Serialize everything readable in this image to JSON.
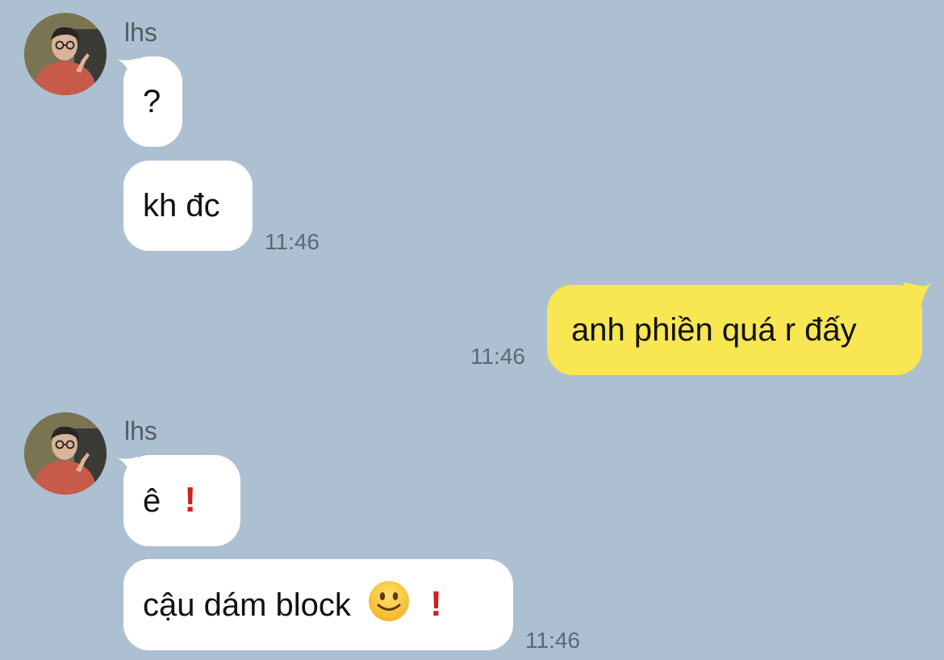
{
  "chat": {
    "groups": [
      {
        "sender": "lhs",
        "messages": [
          {
            "text": "?"
          },
          {
            "text": "kh đc",
            "time": "11:46"
          }
        ]
      },
      {
        "own": true,
        "messages": [
          {
            "text": "anh phiền quá r đấy",
            "time": "11:46"
          }
        ]
      },
      {
        "sender": "lhs",
        "messages": [
          {
            "text": "ê",
            "emoji": [
              "exclamation-mark-icon"
            ]
          },
          {
            "text": "cậu dám block",
            "emoji": [
              "slightly-smiling-face-icon",
              "exclamation-mark-icon"
            ],
            "time": "11:46"
          }
        ]
      }
    ]
  },
  "colors": {
    "background": "#acc0d1",
    "incoming_bubble": "#ffffff",
    "outgoing_bubble": "#f8e653",
    "exclamation": "#d0201c"
  }
}
